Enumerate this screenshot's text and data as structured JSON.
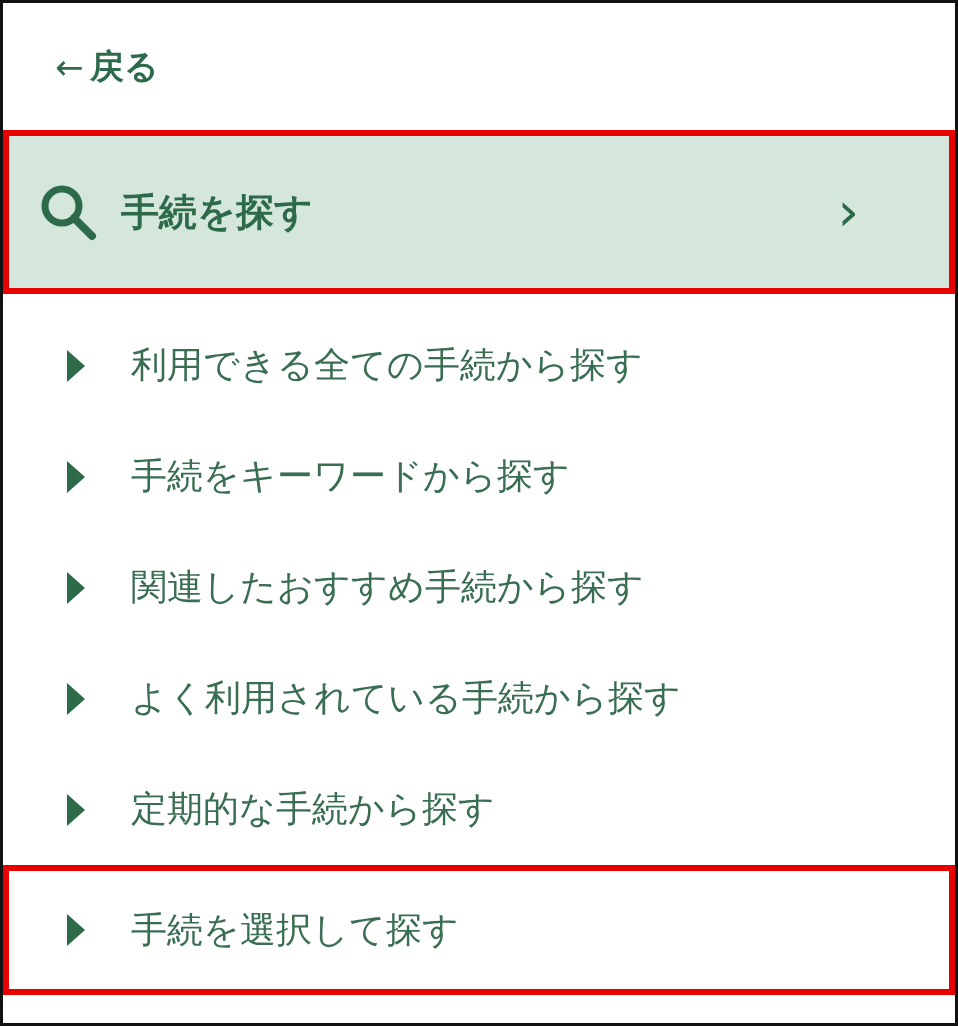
{
  "back_link": {
    "arrow": "←",
    "label": "戻る"
  },
  "section_header": {
    "label": "手続を探す",
    "chevron": "›",
    "highlighted": true
  },
  "menu_items": [
    {
      "label": "利用できる全ての手続から探す",
      "highlighted": false
    },
    {
      "label": "手続をキーワードから探す",
      "highlighted": false
    },
    {
      "label": "関連したおすすめ手続から探す",
      "highlighted": false
    },
    {
      "label": "よく利用されている手続から探す",
      "highlighted": false
    },
    {
      "label": "定期的な手続から探す",
      "highlighted": false
    },
    {
      "label": "手続を選択して探す",
      "highlighted": true
    }
  ]
}
